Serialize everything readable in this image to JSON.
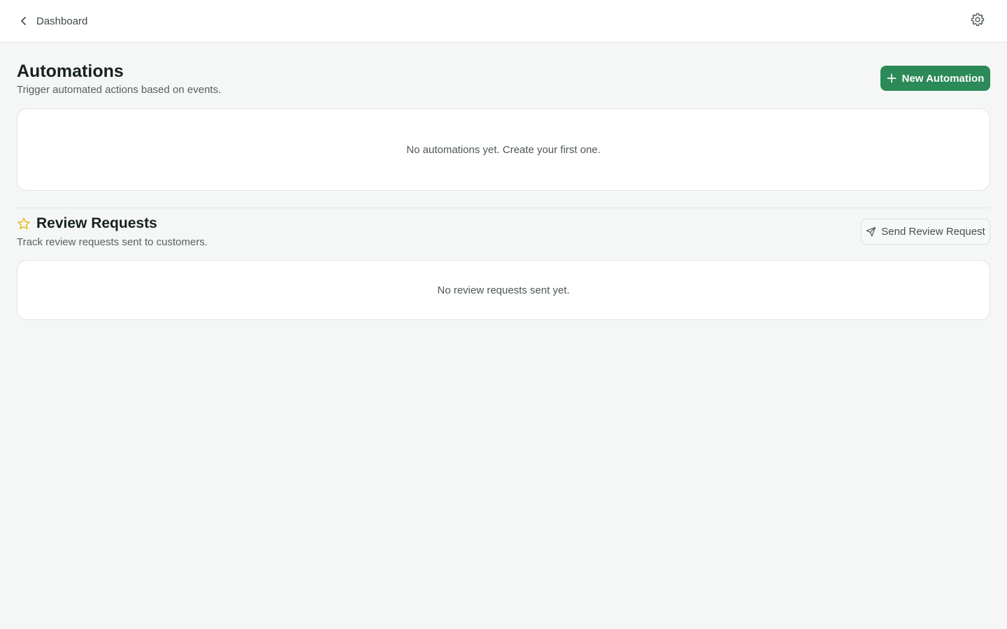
{
  "topbar": {
    "back_label": "Dashboard",
    "back_icon": "chevron-left-icon",
    "settings_icon": "gear-icon"
  },
  "automations": {
    "title": "Automations",
    "subtitle": "Trigger automated actions based on events.",
    "new_button_label": "New Automation",
    "new_button_icon": "plus-icon",
    "empty_message": "No automations yet. Create your first one."
  },
  "reviews": {
    "title": "Review Requests",
    "title_icon": "star-icon",
    "subtitle": "Track review requests sent to customers.",
    "send_button_label": "Send Review Request",
    "send_button_icon": "send-icon",
    "empty_message": "No review requests sent yet."
  },
  "colors": {
    "accent": "#2b8a57",
    "star": "#e8b923",
    "background": "#f5f7f6"
  }
}
